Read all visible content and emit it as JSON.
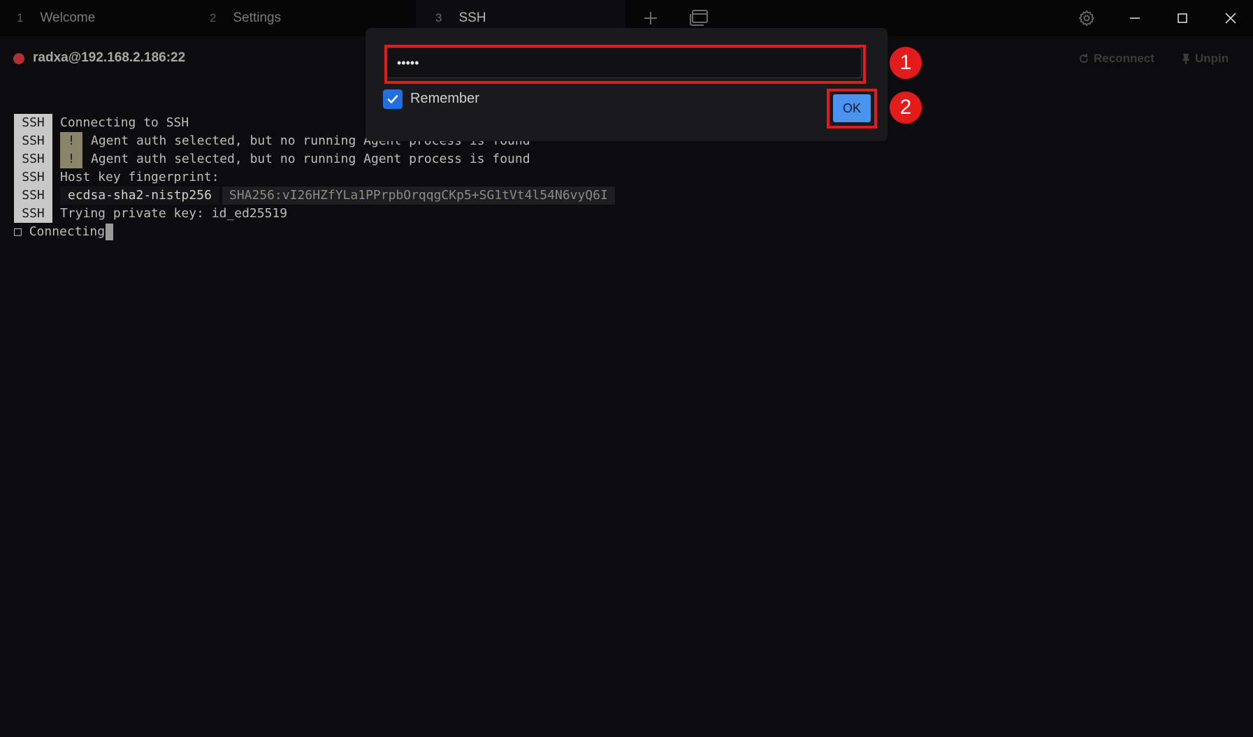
{
  "tabs": [
    {
      "num": "1",
      "label": "Welcome"
    },
    {
      "num": "2",
      "label": "Settings"
    },
    {
      "num": "3",
      "label": "SSH"
    }
  ],
  "toolbar_icons": {
    "new_tab": "plus-icon",
    "tabs_overview": "window-stack-icon",
    "settings": "gear-icon",
    "minimize": "minimize-icon",
    "maximize": "maximize-icon",
    "close": "close-icon"
  },
  "session": {
    "host": "radxa@192.168.2.186:22",
    "status_color": "#b03035",
    "reconnect_label": "Reconnect",
    "unpin_label": "Unpin"
  },
  "terminal": {
    "badge": "SSH",
    "warn_mark": "!",
    "lines": [
      "Connecting to SSH",
      "Agent auth selected, but no running Agent process is found",
      "Agent auth selected, but no running Agent process is found",
      "Host key fingerprint:",
      "Trying private key: id_ed25519"
    ],
    "fingerprint_type": "ecdsa-sha2-nistp256",
    "fingerprint_hash": "SHA256:vI26HZfYLa1PPrpbOrqqgCKp5+SG1tVt4l54N6vyQ6I",
    "connecting": "Connecting"
  },
  "dialog": {
    "password_value": "•••••",
    "remember_label": "Remember",
    "remember_checked": true,
    "ok_label": "OK"
  },
  "annotations": {
    "marker_1": "1",
    "marker_2": "2",
    "highlight_color": "#e51b1b"
  }
}
